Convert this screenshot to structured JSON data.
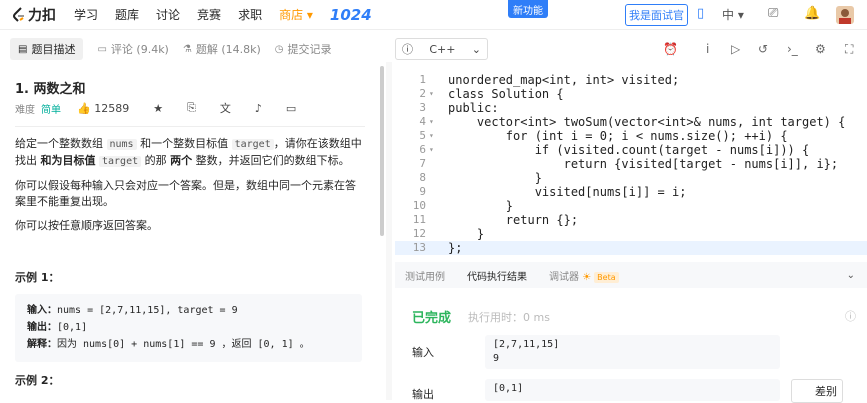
{
  "topnav": {
    "logo": "力扣",
    "items": [
      "学习",
      "题库",
      "讨论",
      "竞赛",
      "求职"
    ],
    "shop": "商店 ▾",
    "promo": "1024",
    "new_feature": "新功能",
    "interviewer": "我是面试官",
    "lang": "中 ▾"
  },
  "left_tabs": {
    "desc": "题目描述",
    "comments": "评论 (9.4k)",
    "solutions": "题解 (14.8k)",
    "submissions": "提交记录"
  },
  "problem": {
    "title": "1. 两数之和",
    "difficulty_label": "难度",
    "difficulty": "简单",
    "likes": "12589",
    "para1_a": "给定一个整数数组 ",
    "para1_code1": "nums",
    "para1_b": " 和一个整数目标值 ",
    "para1_code2": "target",
    "para1_c": "，请你在该数组中找出 ",
    "para1_bold1": "和为目标值",
    "para1_code3": "target",
    "para1_d": " 的那 ",
    "para1_bold2": "两个",
    "para1_e": " 整数，并返回它们的数组下标。",
    "para2": "你可以假设每种输入只会对应一个答案。但是，数组中同一个元素在答案里不能重复出现。",
    "para3": "你可以按任意顺序返回答案。",
    "example1_title": "示例 1：",
    "example1_input_label": "输入：",
    "example1_input": "nums = [2,7,11,15], target = 9",
    "example1_output_label": "输出：",
    "example1_output": "[0,1]",
    "example1_expl_label": "解释：",
    "example1_expl": "因为 nums[0] + nums[1] == 9 ，返回 [0, 1] 。",
    "example2_title": "示例 2："
  },
  "editor": {
    "language": "C++",
    "lines": [
      "unordered_map<int, int> visited;",
      "class Solution {",
      "public:",
      "    vector<int> twoSum(vector<int>& nums, int target) {",
      "        for (int i = 0; i < nums.size(); ++i) {",
      "            if (visited.count(target - nums[i])) {",
      "                return {visited[target - nums[i]], i};",
      "            }",
      "            visited[nums[i]] = i;",
      "        }",
      "        return {};",
      "    }",
      "};"
    ],
    "line_numbers": [
      "1",
      "2",
      "3",
      "4",
      "5",
      "6",
      "7",
      "8",
      "9",
      "10",
      "11",
      "12",
      "13"
    ]
  },
  "bottom_tabs": {
    "testcase": "测试用例",
    "result": "代码执行结果",
    "debugger": "调试器",
    "beta": "Beta"
  },
  "result": {
    "status": "已完成",
    "exec_time": "执行用时：0 ms",
    "input_label": "输入",
    "input_line1": "[2,7,11,15]",
    "input_line2": "9",
    "output_label": "输出",
    "output": "[0,1]",
    "diff": "差别"
  },
  "colors": {
    "accent": "#2f7ef8",
    "easy": "#00af9b",
    "success": "#2db55d",
    "shop": "#ff9900"
  }
}
